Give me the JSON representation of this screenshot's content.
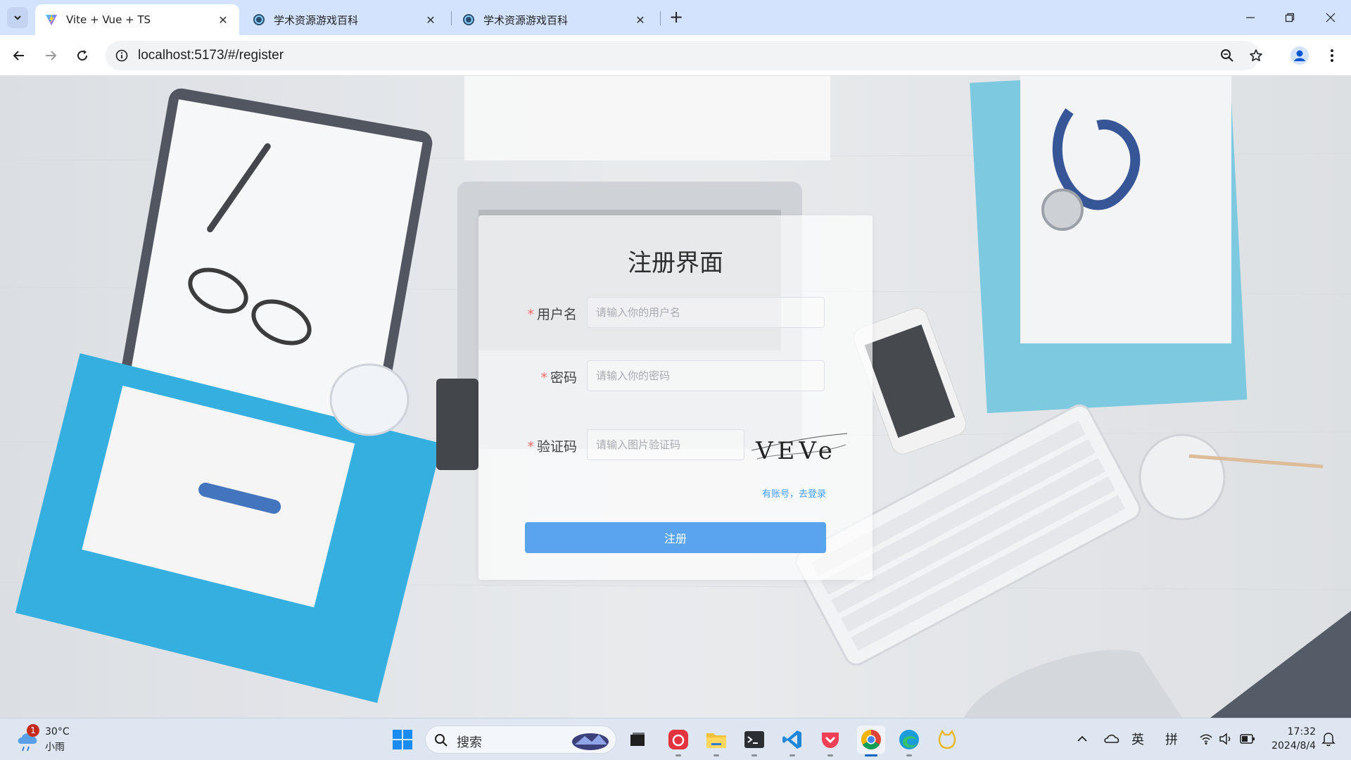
{
  "browser": {
    "tabs": [
      {
        "title": "Vite + Vue + TS",
        "active": true,
        "favicon": "vite-icon"
      },
      {
        "title": "学术资源游戏百科",
        "active": false,
        "favicon": "site-icon"
      },
      {
        "title": "学术资源游戏百科",
        "active": false,
        "favicon": "site-icon"
      }
    ],
    "url": "localhost:5173/#/register"
  },
  "register": {
    "title": "注册界面",
    "username": {
      "label": "用户名",
      "placeholder": "请输入你的用户名",
      "required": true
    },
    "password": {
      "label": "密码",
      "placeholder": "请输入你的密码",
      "required": true
    },
    "captcha": {
      "label": "验证码",
      "placeholder": "请输入图片验证码",
      "required": true,
      "image_text": "VEVe"
    },
    "login_link": "有账号，去登录",
    "submit_label": "注册"
  },
  "taskbar": {
    "weather": {
      "temperature": "30°C",
      "condition": "小雨",
      "badge": "1"
    },
    "search_label": "搜索",
    "tray": {
      "lang": "英",
      "ime": "拼"
    },
    "time": "17:32",
    "date": "2024/8/4"
  },
  "colors": {
    "primary_button": "#5aa4ee",
    "link": "#409eff",
    "required": "#f56c6c",
    "tabbar": "#d3e3fd"
  }
}
